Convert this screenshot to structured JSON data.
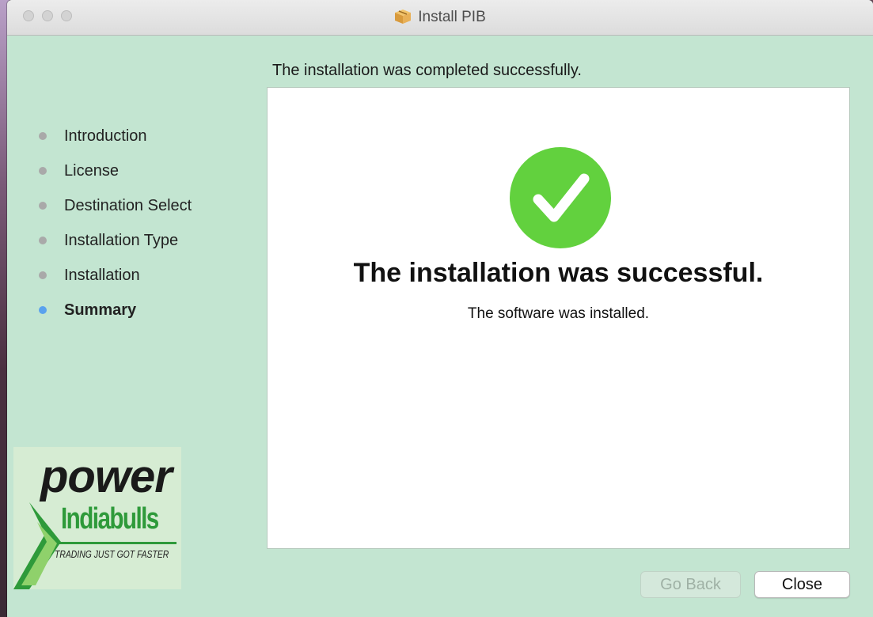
{
  "window": {
    "title": "Install PIB",
    "title_icon": "package-icon"
  },
  "header": {
    "text": "The installation was completed successfully."
  },
  "sidebar": {
    "items": [
      {
        "label": "Introduction",
        "active": false
      },
      {
        "label": "License",
        "active": false
      },
      {
        "label": "Destination Select",
        "active": false
      },
      {
        "label": "Installation Type",
        "active": false
      },
      {
        "label": "Installation",
        "active": false
      },
      {
        "label": "Summary",
        "active": true
      }
    ]
  },
  "main": {
    "status_icon": "success-check-icon",
    "title": "The installation was successful.",
    "subtitle": "The software was installed."
  },
  "logo": {
    "line1": "power",
    "line2": "Indiabulls",
    "tagline": "TRADING JUST GOT FASTER"
  },
  "buttons": {
    "back_label": "Go Back",
    "close_label": "Close"
  },
  "colors": {
    "window_bg": "#c3e5d1",
    "active_dot": "#5aa2ee",
    "inactive_dot": "#a9a9a9",
    "success_green": "#62d13e",
    "brand_green": "#2e9a3a"
  }
}
